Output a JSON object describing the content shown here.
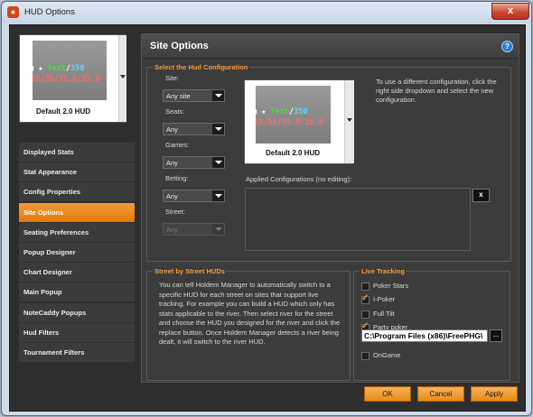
{
  "window": {
    "title": "HUD Options",
    "app_icon": "hm-logo-icon",
    "close_label": "x"
  },
  "sidebar": {
    "preview": {
      "line1_prefix": "■ ★",
      "line1_text": "Text",
      "line1_sep": "/",
      "line1_num": "350",
      "line2": "35/35/35.0/35.0",
      "name": "Default 2.0 HUD"
    },
    "items": [
      {
        "label": "Displayed Stats",
        "active": false
      },
      {
        "label": "Stat Appearance",
        "active": false
      },
      {
        "label": "Config Properties",
        "active": false
      },
      {
        "label": "Site Options",
        "active": true
      },
      {
        "label": "Seating Preferences",
        "active": false
      },
      {
        "label": "Popup Designer",
        "active": false
      },
      {
        "label": "Chart Designer",
        "active": false
      },
      {
        "label": "Main Popup",
        "active": false
      },
      {
        "label": "NoteCaddy Popups",
        "active": false
      },
      {
        "label": "Hud Filters",
        "active": false
      },
      {
        "label": "Tournament Filters",
        "active": false
      }
    ]
  },
  "header": {
    "title": "Site Options",
    "help_icon": "help-icon",
    "help_glyph": "?"
  },
  "hud_config": {
    "group_label": "Select the Hud Configuration",
    "filters": [
      {
        "label": "Site:",
        "value": "Any site",
        "enabled": true
      },
      {
        "label": "Seats:",
        "value": "Any",
        "enabled": true
      },
      {
        "label": "Games:",
        "value": "Any",
        "enabled": true
      },
      {
        "label": "Betting:",
        "value": "Any",
        "enabled": true
      },
      {
        "label": "Street:",
        "value": "Any",
        "enabled": false
      }
    ],
    "preview": {
      "line1_prefix": "■ ★",
      "line1_text": "Text",
      "line1_sep": "/",
      "line1_num": "350",
      "line2": "35/35/35.0/35.0",
      "name": "Default 2.0 HUD"
    },
    "help_text": "To use a different configuration, click the right side dropdown and select the new configuration.",
    "applied_label": "Applied Configurations (no editing):",
    "remove_label": "x"
  },
  "street_huds": {
    "group_label": "Street by Street HUDs",
    "text": "You can tell Holdem Manager to automatically switch to a specific HUD for each street on sites that support live tracking. For example you can build a HUD which only has stats applicable to the river. Then select river for the street and choose the HUD you designed for the river and click the replace button. Once Holdem Manager detects a river being dealt, it will switch to the river HUD."
  },
  "live_tracking": {
    "group_label": "Live Tracking",
    "sites": [
      {
        "label": "Poker Stars",
        "checked": false
      },
      {
        "label": "I-Poker",
        "checked": true
      },
      {
        "label": "Full Tilt",
        "checked": false
      },
      {
        "label": "Party poker",
        "checked": true
      },
      {
        "label": "OnGame",
        "checked": false
      }
    ],
    "path_value": "C:\\Program Files (x86)\\FreePHG\\",
    "browse_label": "..."
  },
  "footer": {
    "ok": "OK",
    "cancel": "Cancel",
    "apply": "Apply"
  },
  "colors": {
    "accent": "#f39c3a",
    "panel": "#3c3c3c",
    "background": "#2e2e2e"
  }
}
